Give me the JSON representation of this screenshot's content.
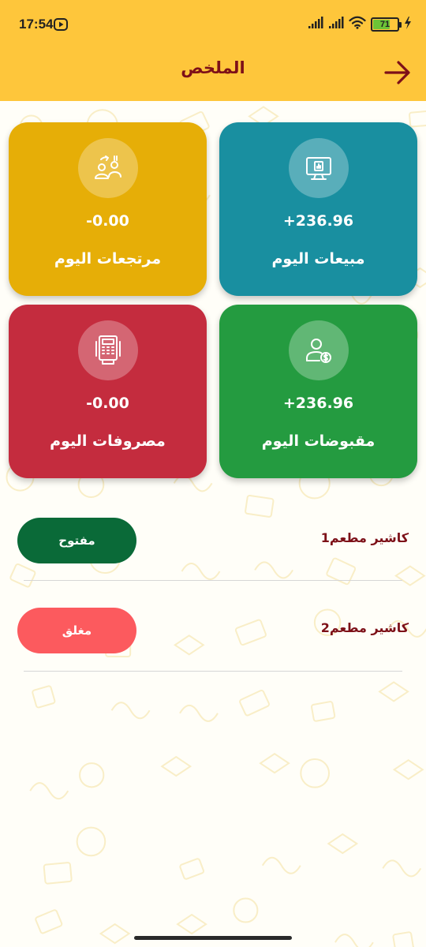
{
  "status_bar": {
    "time": "17:54",
    "battery": "71"
  },
  "header": {
    "title": "الملخص"
  },
  "cards": [
    {
      "label": "مبيعات اليوم",
      "value": "+236.96",
      "color": "#198fa0"
    },
    {
      "label": "مرتجعات اليوم",
      "value": "-0.00",
      "color": "#e6ae07"
    },
    {
      "label": "مقبوضات اليوم",
      "value": "+236.96",
      "color": "#249b40"
    },
    {
      "label": "مصروفات اليوم",
      "value": "-0.00",
      "color": "#c42c3e"
    }
  ],
  "cashiers": [
    {
      "name": "كاشير مطعم1",
      "status": "مفتوح",
      "status_color": "#0a6a38"
    },
    {
      "name": "كاشير مطعم2",
      "status": "مغلق",
      "status_color": "#fc5a5e"
    }
  ],
  "colors": {
    "header_bg": "#fec63b",
    "title_color": "#7d1018"
  }
}
